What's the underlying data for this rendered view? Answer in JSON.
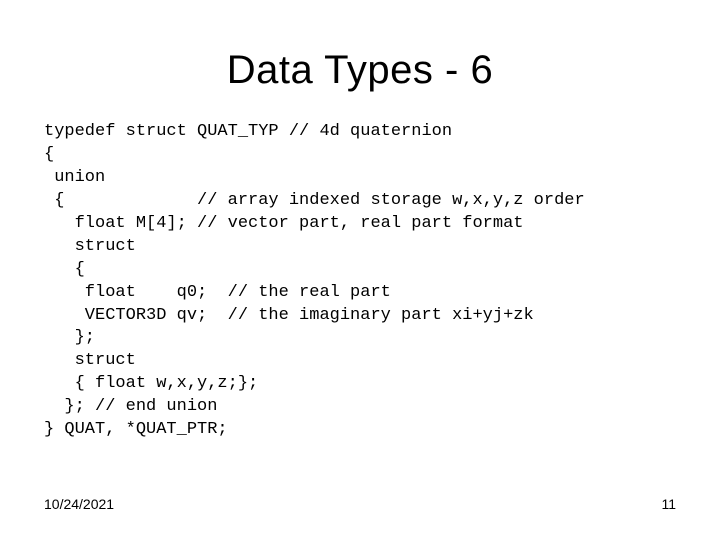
{
  "title": "Data Types - 6",
  "code": "typedef struct QUAT_TYP // 4d quaternion\n{\n union\n {             // array indexed storage w,x,y,z order\n   float M[4]; // vector part, real part format\n   struct\n   {\n    float    q0;  // the real part\n    VECTOR3D qv;  // the imaginary part xi+yj+zk\n   };\n   struct\n   { float w,x,y,z;};\n  }; // end union\n} QUAT, *QUAT_PTR;",
  "footer": {
    "date": "10/24/2021",
    "page": "11"
  }
}
